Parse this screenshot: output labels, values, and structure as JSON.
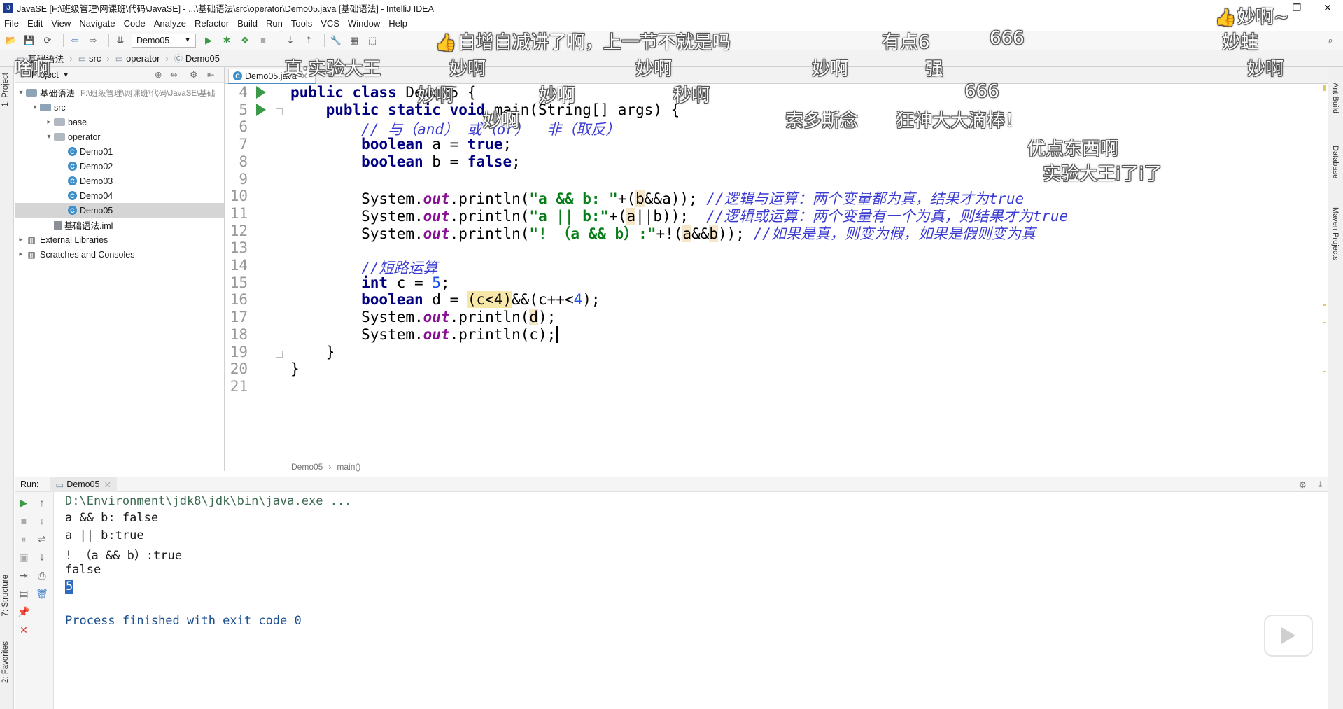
{
  "window": {
    "title": "JavaSE [F:\\班级管理\\网课班\\代码\\JavaSE] - ...\\基础语法\\src\\operator\\Demo05.java [基础语法] - IntelliJ IDEA"
  },
  "menu": [
    "File",
    "Edit",
    "View",
    "Navigate",
    "Code",
    "Analyze",
    "Refactor",
    "Build",
    "Run",
    "Tools",
    "VCS",
    "Window",
    "Help"
  ],
  "toolbar": {
    "run_config": "Demo05"
  },
  "breadcrumb": [
    "基础语法",
    "src",
    "operator",
    "Demo05"
  ],
  "project_panel": {
    "title": "Project",
    "tree": [
      {
        "label": "基础语法",
        "hint": "F:\\班级管理\\网课班\\代码\\JavaSE\\基础",
        "indent": 0,
        "arrow": "▾",
        "icon": "folder"
      },
      {
        "label": "src",
        "indent": 1,
        "arrow": "▾",
        "icon": "folder"
      },
      {
        "label": "base",
        "indent": 2,
        "arrow": "▸",
        "icon": "pkg"
      },
      {
        "label": "operator",
        "indent": 2,
        "arrow": "▾",
        "icon": "pkg"
      },
      {
        "label": "Demo01",
        "indent": 3,
        "arrow": "",
        "icon": "cls"
      },
      {
        "label": "Demo02",
        "indent": 3,
        "arrow": "",
        "icon": "cls"
      },
      {
        "label": "Demo03",
        "indent": 3,
        "arrow": "",
        "icon": "cls"
      },
      {
        "label": "Demo04",
        "indent": 3,
        "arrow": "",
        "icon": "cls"
      },
      {
        "label": "Demo05",
        "indent": 3,
        "arrow": "",
        "icon": "cls",
        "selected": true
      },
      {
        "label": "基础语法.iml",
        "indent": 2,
        "arrow": "",
        "icon": "iml"
      },
      {
        "label": "External Libraries",
        "indent": 0,
        "arrow": "▸",
        "icon": "lib"
      },
      {
        "label": "Scratches and Consoles",
        "indent": 0,
        "arrow": "▸",
        "icon": "lib"
      }
    ]
  },
  "editor": {
    "tab": "Demo05.java",
    "footer": [
      "Demo05",
      "main()"
    ],
    "line_numbers": [
      "4",
      "5",
      "6",
      "7",
      "8",
      "9",
      "10",
      "11",
      "12",
      "13",
      "14",
      "15",
      "16",
      "17",
      "18",
      "19",
      "20",
      "21"
    ],
    "lines": [
      [
        {
          "t": "public class ",
          "c": "kw"
        },
        {
          "t": "Demo05 {",
          "c": ""
        }
      ],
      [
        {
          "t": "    public static void ",
          "c": "kw"
        },
        {
          "t": "main(String[] args) {",
          "c": ""
        }
      ],
      [
        {
          "t": "        // 与（and） 或（or）  非（取反）",
          "c": "cmt"
        }
      ],
      [
        {
          "t": "        boolean ",
          "c": "kw"
        },
        {
          "t": "a = ",
          "c": ""
        },
        {
          "t": "true",
          "c": "kw"
        },
        {
          "t": ";",
          "c": ""
        }
      ],
      [
        {
          "t": "        boolean ",
          "c": "kw"
        },
        {
          "t": "b = ",
          "c": ""
        },
        {
          "t": "false",
          "c": "kw"
        },
        {
          "t": ";",
          "c": ""
        }
      ],
      [
        {
          "t": "",
          "c": ""
        }
      ],
      [
        {
          "t": "        System.",
          "c": ""
        },
        {
          "t": "out",
          "c": "fld"
        },
        {
          "t": ".println(",
          "c": ""
        },
        {
          "t": "\"a && b: \"",
          "c": "str"
        },
        {
          "t": "+(",
          "c": ""
        },
        {
          "t": "b",
          "c": "hl-var"
        },
        {
          "t": "&&a)); ",
          "c": ""
        },
        {
          "t": "//逻辑与运算：两个变量都为真，结果才为true",
          "c": "cmt"
        }
      ],
      [
        {
          "t": "        System.",
          "c": ""
        },
        {
          "t": "out",
          "c": "fld"
        },
        {
          "t": ".println(",
          "c": ""
        },
        {
          "t": "\"a || b:\"",
          "c": "str"
        },
        {
          "t": "+(",
          "c": ""
        },
        {
          "t": "a",
          "c": "hl-var"
        },
        {
          "t": "||b));  ",
          "c": ""
        },
        {
          "t": "//逻辑或运算：两个变量有一个为真，则结果才为true",
          "c": "cmt"
        }
      ],
      [
        {
          "t": "        System.",
          "c": ""
        },
        {
          "t": "out",
          "c": "fld"
        },
        {
          "t": ".println(",
          "c": ""
        },
        {
          "t": "\"! （a && b）:\"",
          "c": "str"
        },
        {
          "t": "+!(",
          "c": ""
        },
        {
          "t": "a",
          "c": "hl-var"
        },
        {
          "t": "&&",
          "c": ""
        },
        {
          "t": "b",
          "c": "hl-var"
        },
        {
          "t": ")); ",
          "c": ""
        },
        {
          "t": "//如果是真，则变为假，如果是假则变为真",
          "c": "cmt"
        }
      ],
      [
        {
          "t": "",
          "c": ""
        }
      ],
      [
        {
          "t": "        //短路运算",
          "c": "cmt"
        }
      ],
      [
        {
          "t": "        int ",
          "c": "kw"
        },
        {
          "t": "c = ",
          "c": ""
        },
        {
          "t": "5",
          "c": "num"
        },
        {
          "t": ";",
          "c": ""
        }
      ],
      [
        {
          "t": "        boolean ",
          "c": "kw"
        },
        {
          "t": "d = ",
          "c": ""
        },
        {
          "t": "(c<4)",
          "c": "hl-paren"
        },
        {
          "t": "&&(c++<",
          "c": ""
        },
        {
          "t": "4",
          "c": "num"
        },
        {
          "t": ");",
          "c": ""
        }
      ],
      [
        {
          "t": "        System.",
          "c": ""
        },
        {
          "t": "out",
          "c": "fld"
        },
        {
          "t": ".println(",
          "c": ""
        },
        {
          "t": "d",
          "c": "hl-var"
        },
        {
          "t": ");",
          "c": ""
        }
      ],
      [
        {
          "t": "        System.",
          "c": ""
        },
        {
          "t": "out",
          "c": "fld"
        },
        {
          "t": ".println(c);",
          "c": ""
        }
      ],
      [
        {
          "t": "    }",
          "c": ""
        }
      ],
      [
        {
          "t": "}",
          "c": ""
        }
      ],
      [
        {
          "t": "",
          "c": ""
        }
      ]
    ]
  },
  "run_panel": {
    "label": "Run:",
    "tab": "Demo05",
    "output": [
      {
        "text": "D:\\Environment\\jdk8\\jdk\\bin\\java.exe ...",
        "style": "cmd"
      },
      {
        "text": "a && b: false",
        "style": ""
      },
      {
        "text": "a || b:true",
        "style": ""
      },
      {
        "text": "! （a && b）:true",
        "style": ""
      },
      {
        "text": "false",
        "style": ""
      },
      {
        "text": "5",
        "style": "sel"
      },
      {
        "text": "",
        "style": ""
      },
      {
        "text": "Process finished with exit code 0",
        "style": "exit"
      }
    ]
  },
  "side_tabs": {
    "left": [
      "1: Project",
      "7: Structure",
      "2: Favorites"
    ],
    "right": [
      "Ant Build",
      "Database",
      "Maven Projects"
    ]
  },
  "danmaku": [
    {
      "text": "妙啊~",
      "thumb": true
    },
    {
      "text": "自增自减讲了啊，上一节不就是吗",
      "thumb": true
    },
    {
      "text": "有点6"
    },
    {
      "text": "666"
    },
    {
      "text": "妙蛙"
    },
    {
      "text": "啥啊"
    },
    {
      "text": "真·实验大王"
    },
    {
      "text": "妙啊"
    },
    {
      "text": "妙啊"
    },
    {
      "text": "妙啊"
    },
    {
      "text": "强"
    },
    {
      "text": "妙啊"
    },
    {
      "text": "妙啊"
    },
    {
      "text": "妙啊"
    },
    {
      "text": "秒啊"
    },
    {
      "text": "666"
    },
    {
      "text": "妙啊"
    },
    {
      "text": "索多斯念"
    },
    {
      "text": "狂神大大滴棒！"
    },
    {
      "text": "优点东西啊"
    },
    {
      "text": "实验大王i了i了"
    }
  ]
}
